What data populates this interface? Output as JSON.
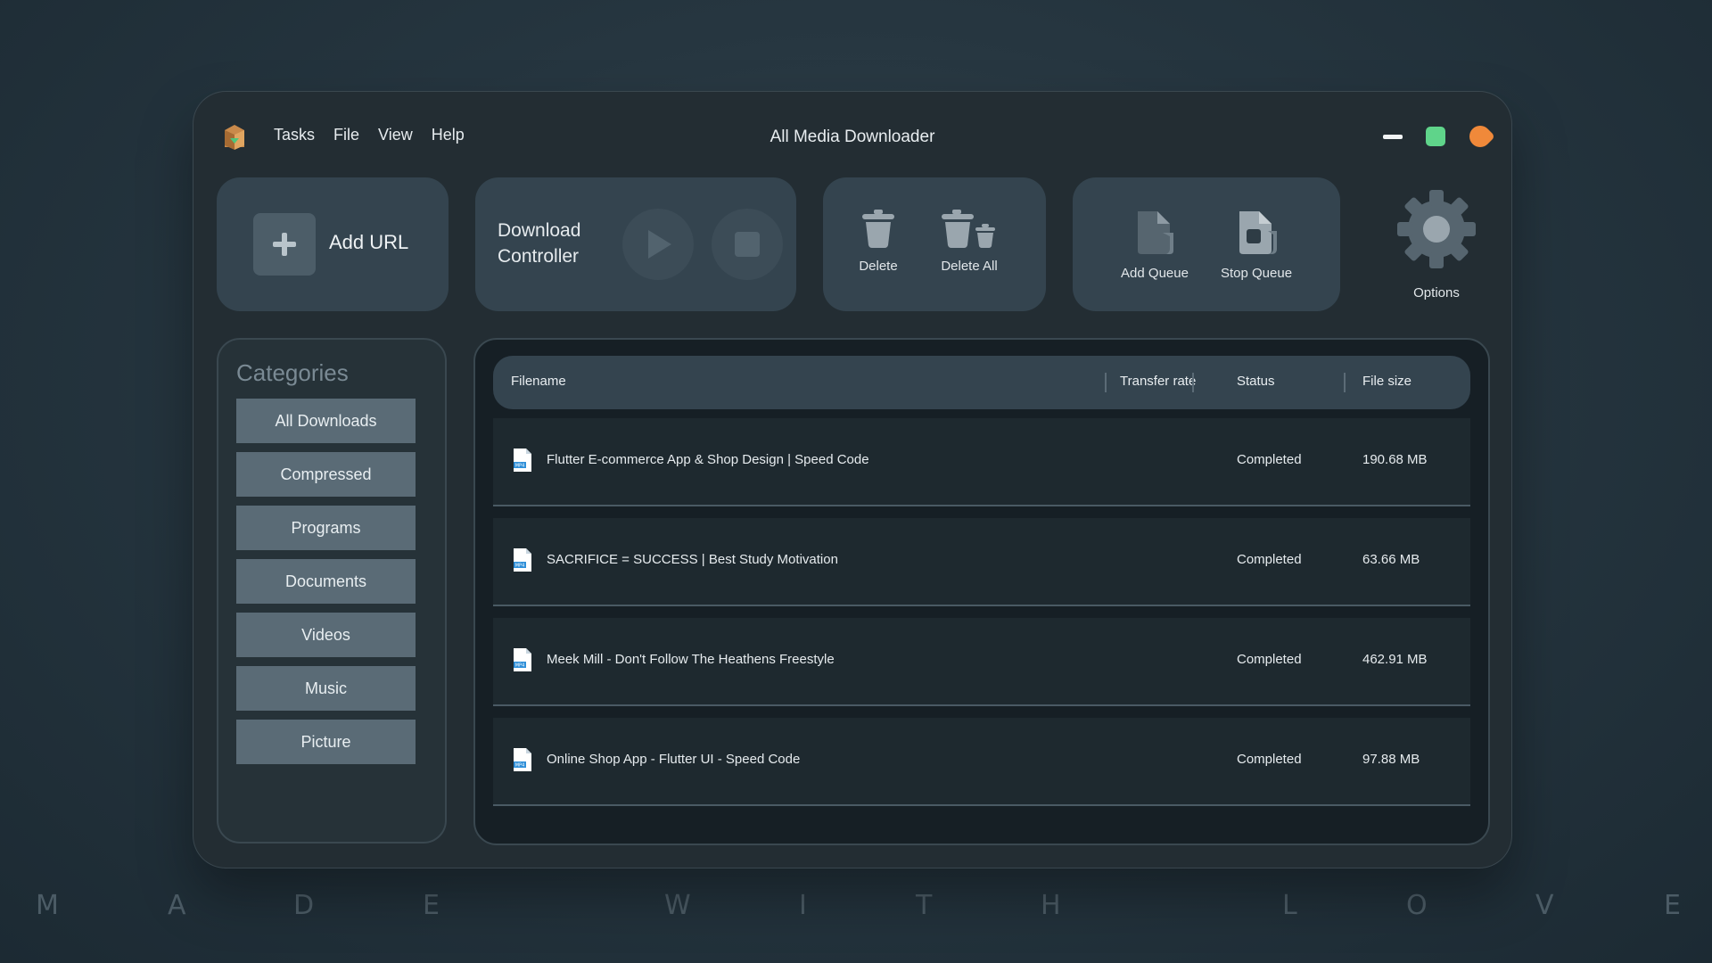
{
  "app": {
    "title": "All Media Downloader"
  },
  "menu": [
    "Tasks",
    "File",
    "View",
    "Help"
  ],
  "toolbar": {
    "add_url": "Add URL",
    "download_controller": "Download Controller",
    "delete": "Delete",
    "delete_all": "Delete All",
    "add_queue": "Add Queue",
    "stop_queue": "Stop Queue",
    "options": "Options"
  },
  "categories": {
    "title": "Categories",
    "items": [
      "All Downloads",
      "Compressed",
      "Programs",
      "Documents",
      "Videos",
      "Music",
      "Picture"
    ]
  },
  "table": {
    "columns": [
      "Filename",
      "Transfer rate",
      "Status",
      "File size"
    ],
    "rows": [
      {
        "icon": "mp4-file-icon",
        "filename": "Flutter E-commerce App & Shop Design | Speed Code",
        "transfer_rate": "",
        "status": "Completed",
        "size": "190.68 MB"
      },
      {
        "icon": "mp4-file-icon",
        "filename": "SACRIFICE = SUCCESS | Best Study Motivation",
        "transfer_rate": "",
        "status": "Completed",
        "size": "63.66 MB"
      },
      {
        "icon": "mp4-file-icon",
        "filename": "Meek Mill - Don't Follow The Heathens Freestyle",
        "transfer_rate": "",
        "status": "Completed",
        "size": "462.91 MB"
      },
      {
        "icon": "mp4-file-icon",
        "filename": "Online Shop App - Flutter UI - Speed Code",
        "transfer_rate": "",
        "status": "Completed",
        "size": "97.88 MB"
      }
    ]
  },
  "background_text": [
    "M",
    "A",
    "D",
    "E",
    "W",
    "I",
    "T",
    "H",
    "L",
    "O",
    "V",
    "E"
  ],
  "colors": {
    "window": "#232d33",
    "card": "#34444f",
    "category_button": "#5a6b76",
    "maximize": "#5fd48a",
    "close": "#f0893a"
  }
}
